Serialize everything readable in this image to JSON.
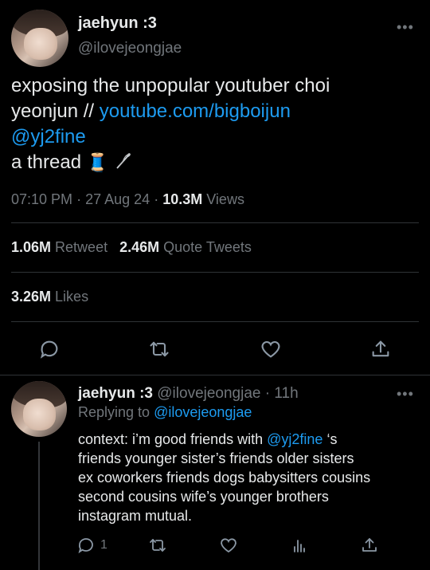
{
  "tweet": {
    "display_name": "jaehyun :3",
    "handle": "@ilovejeongjae",
    "more": "•••",
    "text_line1": "exposing the unpopular youtuber choi",
    "text_line2_prefix": "yeonjun // ",
    "text_link": "youtube.com/bigboijun",
    "text_mention": "@yj2fine",
    "text_line4": "a thread",
    "time": "07:10 PM",
    "sep": "·",
    "date": "27 Aug 24",
    "views_count": "10.3M",
    "views_label": "Views",
    "retweets_count": "1.06M",
    "retweets_label": "Retweet",
    "quotes_count": "2.46M",
    "quotes_label": "Quote Tweets",
    "likes_count": "3.26M",
    "likes_label": "Likes",
    "emoji_thread": "🧵",
    "emoji_needle": "🪡"
  },
  "reply": {
    "display_name": "jaehyun :3",
    "handle": "@ilovejeongjae",
    "sep": "·",
    "age": "11h",
    "more": "•••",
    "replying_label": "Replying to",
    "replying_to": "@ilovejeongjae",
    "text_prefix": "context: i’m good friends with ",
    "text_mention": "@yj2fine",
    "text_suffix": " ‘s",
    "text_line2": "friends younger sister’s friends older sisters",
    "text_line3": "ex coworkers friends dogs babysitters cousins",
    "text_line4": "second cousins wife’s younger brothers",
    "text_line5": "instagram mutual.",
    "reply_count": "1"
  },
  "colors": {
    "background": "#000000",
    "text": "#e7e9ea",
    "muted": "#71767b",
    "link": "#1d9bf0",
    "divider": "#2f3336"
  }
}
